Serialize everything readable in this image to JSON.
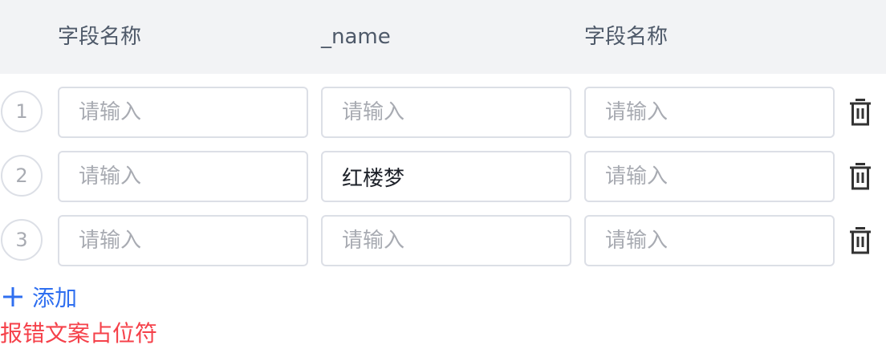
{
  "table": {
    "headers": [
      "字段名称",
      "_name",
      "字段名称"
    ],
    "rows": [
      {
        "index": "1",
        "cells": [
          {
            "value": "",
            "placeholder": "请输入"
          },
          {
            "value": "",
            "placeholder": "请输入"
          },
          {
            "value": "",
            "placeholder": "请输入"
          }
        ]
      },
      {
        "index": "2",
        "cells": [
          {
            "value": "",
            "placeholder": "请输入"
          },
          {
            "value": "红楼梦",
            "placeholder": "请输入"
          },
          {
            "value": "",
            "placeholder": "请输入"
          }
        ]
      },
      {
        "index": "3",
        "cells": [
          {
            "value": "",
            "placeholder": "请输入"
          },
          {
            "value": "",
            "placeholder": "请输入"
          },
          {
            "value": "",
            "placeholder": "请输入"
          }
        ]
      }
    ],
    "row_action_icon": "trash-icon"
  },
  "actions": {
    "add_label": "添加",
    "add_icon": "plus-icon"
  },
  "error": {
    "message": "报错文案占位符"
  },
  "colors": {
    "header_bg": "#f2f3f5",
    "accent": "#2f6ff0",
    "error": "#f5414a",
    "border": "#dcdfe6",
    "placeholder": "#a8abb2"
  }
}
